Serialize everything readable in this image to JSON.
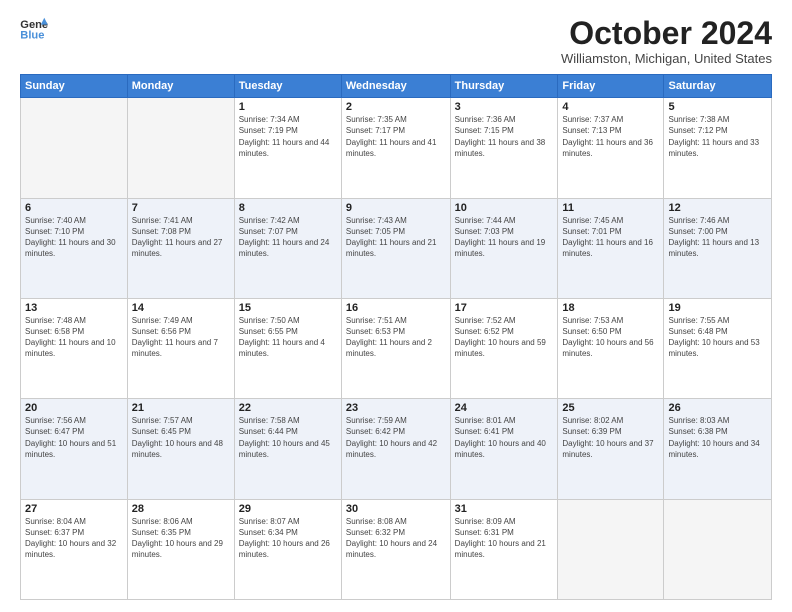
{
  "logo": {
    "line1": "General",
    "line2": "Blue"
  },
  "title": "October 2024",
  "location": "Williamston, Michigan, United States",
  "weekdays": [
    "Sunday",
    "Monday",
    "Tuesday",
    "Wednesday",
    "Thursday",
    "Friday",
    "Saturday"
  ],
  "weeks": [
    [
      {
        "day": "",
        "sunrise": "",
        "sunset": "",
        "daylight": ""
      },
      {
        "day": "",
        "sunrise": "",
        "sunset": "",
        "daylight": ""
      },
      {
        "day": "1",
        "sunrise": "Sunrise: 7:34 AM",
        "sunset": "Sunset: 7:19 PM",
        "daylight": "Daylight: 11 hours and 44 minutes."
      },
      {
        "day": "2",
        "sunrise": "Sunrise: 7:35 AM",
        "sunset": "Sunset: 7:17 PM",
        "daylight": "Daylight: 11 hours and 41 minutes."
      },
      {
        "day": "3",
        "sunrise": "Sunrise: 7:36 AM",
        "sunset": "Sunset: 7:15 PM",
        "daylight": "Daylight: 11 hours and 38 minutes."
      },
      {
        "day": "4",
        "sunrise": "Sunrise: 7:37 AM",
        "sunset": "Sunset: 7:13 PM",
        "daylight": "Daylight: 11 hours and 36 minutes."
      },
      {
        "day": "5",
        "sunrise": "Sunrise: 7:38 AM",
        "sunset": "Sunset: 7:12 PM",
        "daylight": "Daylight: 11 hours and 33 minutes."
      }
    ],
    [
      {
        "day": "6",
        "sunrise": "Sunrise: 7:40 AM",
        "sunset": "Sunset: 7:10 PM",
        "daylight": "Daylight: 11 hours and 30 minutes."
      },
      {
        "day": "7",
        "sunrise": "Sunrise: 7:41 AM",
        "sunset": "Sunset: 7:08 PM",
        "daylight": "Daylight: 11 hours and 27 minutes."
      },
      {
        "day": "8",
        "sunrise": "Sunrise: 7:42 AM",
        "sunset": "Sunset: 7:07 PM",
        "daylight": "Daylight: 11 hours and 24 minutes."
      },
      {
        "day": "9",
        "sunrise": "Sunrise: 7:43 AM",
        "sunset": "Sunset: 7:05 PM",
        "daylight": "Daylight: 11 hours and 21 minutes."
      },
      {
        "day": "10",
        "sunrise": "Sunrise: 7:44 AM",
        "sunset": "Sunset: 7:03 PM",
        "daylight": "Daylight: 11 hours and 19 minutes."
      },
      {
        "day": "11",
        "sunrise": "Sunrise: 7:45 AM",
        "sunset": "Sunset: 7:01 PM",
        "daylight": "Daylight: 11 hours and 16 minutes."
      },
      {
        "day": "12",
        "sunrise": "Sunrise: 7:46 AM",
        "sunset": "Sunset: 7:00 PM",
        "daylight": "Daylight: 11 hours and 13 minutes."
      }
    ],
    [
      {
        "day": "13",
        "sunrise": "Sunrise: 7:48 AM",
        "sunset": "Sunset: 6:58 PM",
        "daylight": "Daylight: 11 hours and 10 minutes."
      },
      {
        "day": "14",
        "sunrise": "Sunrise: 7:49 AM",
        "sunset": "Sunset: 6:56 PM",
        "daylight": "Daylight: 11 hours and 7 minutes."
      },
      {
        "day": "15",
        "sunrise": "Sunrise: 7:50 AM",
        "sunset": "Sunset: 6:55 PM",
        "daylight": "Daylight: 11 hours and 4 minutes."
      },
      {
        "day": "16",
        "sunrise": "Sunrise: 7:51 AM",
        "sunset": "Sunset: 6:53 PM",
        "daylight": "Daylight: 11 hours and 2 minutes."
      },
      {
        "day": "17",
        "sunrise": "Sunrise: 7:52 AM",
        "sunset": "Sunset: 6:52 PM",
        "daylight": "Daylight: 10 hours and 59 minutes."
      },
      {
        "day": "18",
        "sunrise": "Sunrise: 7:53 AM",
        "sunset": "Sunset: 6:50 PM",
        "daylight": "Daylight: 10 hours and 56 minutes."
      },
      {
        "day": "19",
        "sunrise": "Sunrise: 7:55 AM",
        "sunset": "Sunset: 6:48 PM",
        "daylight": "Daylight: 10 hours and 53 minutes."
      }
    ],
    [
      {
        "day": "20",
        "sunrise": "Sunrise: 7:56 AM",
        "sunset": "Sunset: 6:47 PM",
        "daylight": "Daylight: 10 hours and 51 minutes."
      },
      {
        "day": "21",
        "sunrise": "Sunrise: 7:57 AM",
        "sunset": "Sunset: 6:45 PM",
        "daylight": "Daylight: 10 hours and 48 minutes."
      },
      {
        "day": "22",
        "sunrise": "Sunrise: 7:58 AM",
        "sunset": "Sunset: 6:44 PM",
        "daylight": "Daylight: 10 hours and 45 minutes."
      },
      {
        "day": "23",
        "sunrise": "Sunrise: 7:59 AM",
        "sunset": "Sunset: 6:42 PM",
        "daylight": "Daylight: 10 hours and 42 minutes."
      },
      {
        "day": "24",
        "sunrise": "Sunrise: 8:01 AM",
        "sunset": "Sunset: 6:41 PM",
        "daylight": "Daylight: 10 hours and 40 minutes."
      },
      {
        "day": "25",
        "sunrise": "Sunrise: 8:02 AM",
        "sunset": "Sunset: 6:39 PM",
        "daylight": "Daylight: 10 hours and 37 minutes."
      },
      {
        "day": "26",
        "sunrise": "Sunrise: 8:03 AM",
        "sunset": "Sunset: 6:38 PM",
        "daylight": "Daylight: 10 hours and 34 minutes."
      }
    ],
    [
      {
        "day": "27",
        "sunrise": "Sunrise: 8:04 AM",
        "sunset": "Sunset: 6:37 PM",
        "daylight": "Daylight: 10 hours and 32 minutes."
      },
      {
        "day": "28",
        "sunrise": "Sunrise: 8:06 AM",
        "sunset": "Sunset: 6:35 PM",
        "daylight": "Daylight: 10 hours and 29 minutes."
      },
      {
        "day": "29",
        "sunrise": "Sunrise: 8:07 AM",
        "sunset": "Sunset: 6:34 PM",
        "daylight": "Daylight: 10 hours and 26 minutes."
      },
      {
        "day": "30",
        "sunrise": "Sunrise: 8:08 AM",
        "sunset": "Sunset: 6:32 PM",
        "daylight": "Daylight: 10 hours and 24 minutes."
      },
      {
        "day": "31",
        "sunrise": "Sunrise: 8:09 AM",
        "sunset": "Sunset: 6:31 PM",
        "daylight": "Daylight: 10 hours and 21 minutes."
      },
      {
        "day": "",
        "sunrise": "",
        "sunset": "",
        "daylight": ""
      },
      {
        "day": "",
        "sunrise": "",
        "sunset": "",
        "daylight": ""
      }
    ]
  ]
}
